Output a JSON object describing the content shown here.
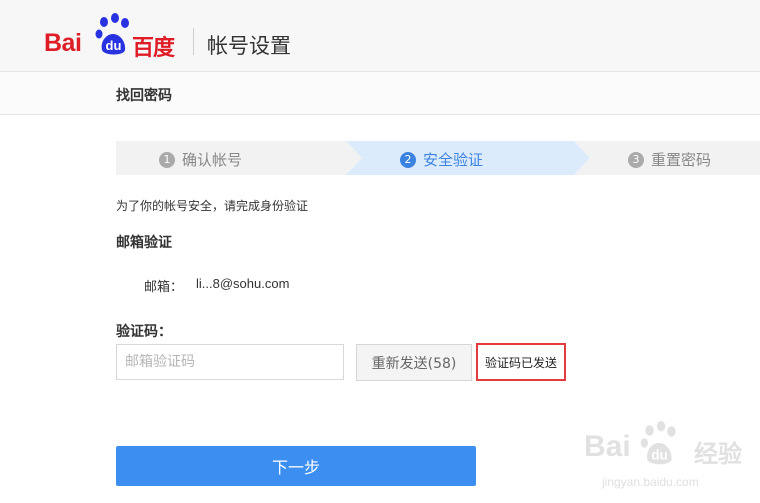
{
  "header": {
    "logo_latin": "Bai",
    "logo_du": "du",
    "logo_chinese": "百度",
    "title": "帐号设置"
  },
  "subbar": {
    "title": "找回密码"
  },
  "steps": [
    {
      "num": "1",
      "label": "确认帐号",
      "state": "done"
    },
    {
      "num": "2",
      "label": "安全验证",
      "state": "active"
    },
    {
      "num": "3",
      "label": "重置密码",
      "state": "pending"
    }
  ],
  "content": {
    "intro": "为了你的帐号安全，请完成身份验证",
    "section_title": "邮箱验证",
    "email_label": "邮箱：",
    "email_value": "li...8@sohu.com",
    "code_label": "验证码：",
    "code_placeholder": "邮箱验证码",
    "code_value": "",
    "resend_label": "重新发送(58)",
    "sent_note": "验证码已发送",
    "next_label": "下一步"
  },
  "watermark": {
    "brand": "Bai",
    "brand_du": "du",
    "cn": "经验",
    "url": "jingyan.baidu.com"
  },
  "colors": {
    "brand_red": "#de1d26",
    "brand_blue": "#2932e1",
    "active_step_bg": "#dcebfc",
    "active_step_text": "#3c83e1",
    "inactive_step_bg": "#f2f2f2",
    "primary_button": "#3c8ff0",
    "highlight_border": "#e43c3c"
  }
}
